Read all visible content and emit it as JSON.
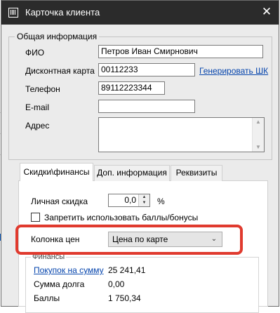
{
  "window": {
    "title": "Карточка клиента"
  },
  "general": {
    "legend": "Общая информация",
    "fio_label": "ФИО",
    "fio_value": "Петров Иван Смирнович",
    "discount_card_label": "Дисконтная карта",
    "discount_card_value": "00112233",
    "generate_link": "Генерировать ШК",
    "phone_label": "Телефон",
    "phone_value": "89112223344",
    "email_label": "E-mail",
    "email_value": "",
    "address_label": "Адрес",
    "address_value": ""
  },
  "tabs": [
    {
      "label": "Скидки\\финансы",
      "active": true
    },
    {
      "label": "Доп. информация",
      "active": false
    },
    {
      "label": "Реквизиты",
      "active": false
    }
  ],
  "discounts": {
    "personal_discount_label": "Личная скидка",
    "personal_discount_value": "0,0",
    "percent_sign": "%",
    "forbid_bonuses_label": "Запретить использовать баллы/бонусы",
    "forbid_bonuses_checked": false,
    "price_column_label": "Колонка цен",
    "price_column_value": "Цена по карте"
  },
  "finances": {
    "legend": "Финансы",
    "purchases_label": "Покупок на сумму",
    "purchases_value": "25 241,41",
    "debt_label": "Сумма долга",
    "debt_value": "0,00",
    "points_label": "Баллы",
    "points_value": "1 750,34"
  },
  "colors": {
    "titlebar": "#2b2b2b",
    "dialog_bg": "#ebebeb",
    "link": "#0645ad",
    "highlight": "#e03a2e"
  }
}
